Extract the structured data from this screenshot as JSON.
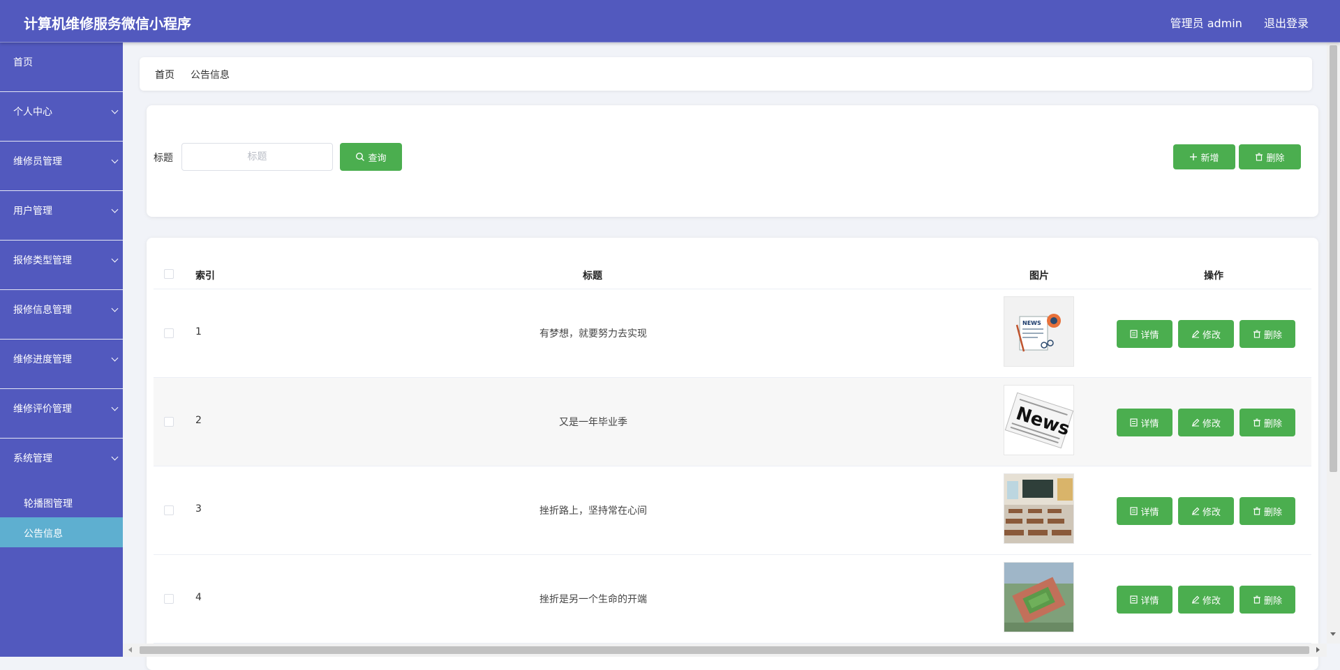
{
  "header": {
    "title": "计算机维修服务微信小程序",
    "user": "管理员 admin",
    "logout": "退出登录"
  },
  "sidebar": {
    "items": [
      {
        "label": "首页"
      },
      {
        "label": "个人中心"
      },
      {
        "label": "维修员管理"
      },
      {
        "label": "用户管理"
      },
      {
        "label": "报修类型管理"
      },
      {
        "label": "报修信息管理"
      },
      {
        "label": "维修进度管理"
      },
      {
        "label": "维修评价管理"
      },
      {
        "label": "系统管理"
      }
    ],
    "subitems": [
      {
        "label": "轮播图管理"
      },
      {
        "label": "公告信息"
      }
    ]
  },
  "breadcrumb": {
    "home": "首页",
    "current": "公告信息"
  },
  "filter": {
    "label": "标题",
    "placeholder": "标题",
    "search": "查询",
    "add": "新增",
    "delete": "删除"
  },
  "table": {
    "headers": {
      "index": "索引",
      "title": "标题",
      "image": "图片",
      "actions": "操作"
    },
    "rows": [
      {
        "index": "1",
        "title": "有梦想，就要努力去实现"
      },
      {
        "index": "2",
        "title": "又是一年毕业季"
      },
      {
        "index": "3",
        "title": "挫折路上，坚持常在心间"
      },
      {
        "index": "4",
        "title": "挫折是另一个生命的开端"
      }
    ],
    "actions": {
      "detail": "详情",
      "edit": "修改",
      "delete": "删除"
    },
    "thumb_texts": {
      "news1": "NEWS",
      "news2": "News"
    }
  },
  "colors": {
    "primary": "#5259be",
    "button": "#4bae4f",
    "active_menu": "#5eafd0"
  }
}
